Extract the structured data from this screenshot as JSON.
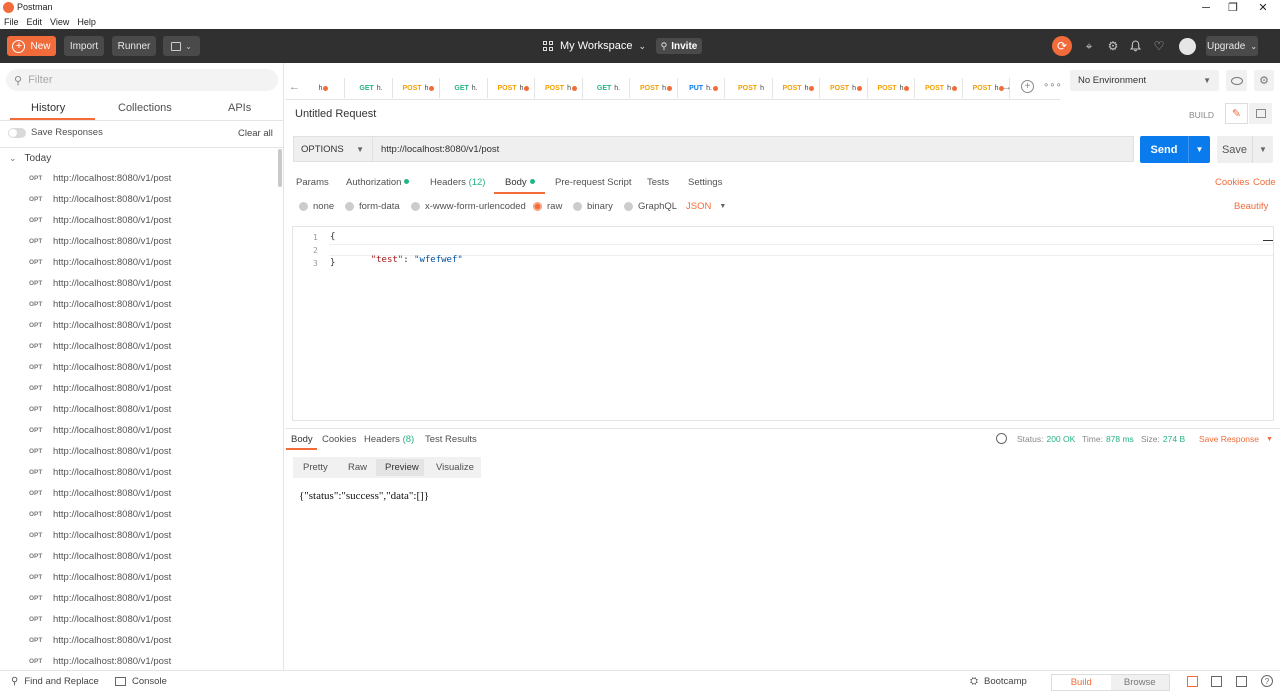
{
  "window": {
    "title": "Postman",
    "menu": [
      "File",
      "Edit",
      "View",
      "Help"
    ],
    "controls": {
      "minimize": "─",
      "maximize": "❐",
      "close": "✕"
    }
  },
  "header": {
    "new_label": "New",
    "import_label": "Import",
    "runner_label": "Runner",
    "workspace_label": "My Workspace",
    "invite_label": "Invite",
    "upgrade_label": "Upgrade"
  },
  "sidebar": {
    "filter_placeholder": "Filter",
    "tabs": [
      "History",
      "Collections",
      "APIs"
    ],
    "save_responses_label": "Save Responses",
    "clear_all_label": "Clear all",
    "group_label": "Today",
    "items": [
      {
        "method": "OPT",
        "url": "http://localhost:8080/v1/post"
      },
      {
        "method": "OPT",
        "url": "http://localhost:8080/v1/post"
      },
      {
        "method": "OPT",
        "url": "http://localhost:8080/v1/post"
      },
      {
        "method": "OPT",
        "url": "http://localhost:8080/v1/post"
      },
      {
        "method": "OPT",
        "url": "http://localhost:8080/v1/post"
      },
      {
        "method": "OPT",
        "url": "http://localhost:8080/v1/post"
      },
      {
        "method": "OPT",
        "url": "http://localhost:8080/v1/post"
      },
      {
        "method": "OPT",
        "url": "http://localhost:8080/v1/post"
      },
      {
        "method": "OPT",
        "url": "http://localhost:8080/v1/post"
      },
      {
        "method": "OPT",
        "url": "http://localhost:8080/v1/post"
      },
      {
        "method": "OPT",
        "url": "http://localhost:8080/v1/post"
      },
      {
        "method": "OPT",
        "url": "http://localhost:8080/v1/post"
      },
      {
        "method": "OPT",
        "url": "http://localhost:8080/v1/post"
      },
      {
        "method": "OPT",
        "url": "http://localhost:8080/v1/post"
      },
      {
        "method": "OPT",
        "url": "http://localhost:8080/v1/post"
      },
      {
        "method": "OPT",
        "url": "http://localhost:8080/v1/post"
      },
      {
        "method": "OPT",
        "url": "http://localhost:8080/v1/post"
      },
      {
        "method": "OPT",
        "url": "http://localhost:8080/v1/post"
      },
      {
        "method": "OPT",
        "url": "http://localhost:8080/v1/post"
      },
      {
        "method": "OPT",
        "url": "http://localhost:8080/v1/post"
      },
      {
        "method": "OPT",
        "url": "http://localhost:8080/v1/post"
      },
      {
        "method": "OPT",
        "url": "http://localhost:8080/v1/post"
      },
      {
        "method": "OPT",
        "url": "http://localhost:8080/v1/post"
      },
      {
        "method": "OPT",
        "url": "http://localhost:8080/v1/post"
      }
    ]
  },
  "request_tabs": [
    {
      "method": "",
      "name": "h",
      "dot": true
    },
    {
      "method": "GET",
      "name": "h.",
      "dot": false
    },
    {
      "method": "POST",
      "name": "h",
      "dot": true
    },
    {
      "method": "GET",
      "name": "h.",
      "dot": false
    },
    {
      "method": "POST",
      "name": "h",
      "dot": true
    },
    {
      "method": "POST",
      "name": "h",
      "dot": true
    },
    {
      "method": "GET",
      "name": "h.",
      "dot": false
    },
    {
      "method": "POST",
      "name": "h",
      "dot": true
    },
    {
      "method": "PUT",
      "name": "h.",
      "dot": true
    },
    {
      "method": "POST",
      "name": "h",
      "dot": false
    },
    {
      "method": "POST",
      "name": "h",
      "dot": true
    },
    {
      "method": "POST",
      "name": "h",
      "dot": true
    },
    {
      "method": "POST",
      "name": "h",
      "dot": true
    },
    {
      "method": "POST",
      "name": "h",
      "dot": true
    },
    {
      "method": "POST",
      "name": "h",
      "dot": true
    }
  ],
  "environment": {
    "selected": "No Environment"
  },
  "request": {
    "name": "Untitled Request",
    "build_label": "BUILD",
    "method": "OPTIONS",
    "url": "http://localhost:8080/v1/post",
    "send_label": "Send",
    "save_label": "Save",
    "tabs": [
      {
        "label": "Params"
      },
      {
        "label": "Authorization",
        "dot": true
      },
      {
        "label": "Headers",
        "count": "(12)"
      },
      {
        "label": "Body",
        "dot": true
      },
      {
        "label": "Pre-request Script"
      },
      {
        "label": "Tests"
      },
      {
        "label": "Settings"
      }
    ],
    "cookies_label": "Cookies",
    "code_label": "Code",
    "body_types": [
      "none",
      "form-data",
      "x-www-form-urlencoded",
      "raw",
      "binary",
      "GraphQL"
    ],
    "selected_body_type": "raw",
    "format": "JSON",
    "beautify_label": "Beautify",
    "code_lines": [
      {
        "n": "1",
        "text": "{"
      },
      {
        "n": "2",
        "key": "\"test\"",
        "sep": ": ",
        "value": "\"wfefwef\""
      },
      {
        "n": "3",
        "text": "}"
      }
    ]
  },
  "response": {
    "tabs": [
      {
        "label": "Body"
      },
      {
        "label": "Cookies"
      },
      {
        "label": "Headers",
        "count": "(8)"
      },
      {
        "label": "Test Results"
      }
    ],
    "status_label": "Status:",
    "status_value": "200 OK",
    "time_label": "Time:",
    "time_value": "878 ms",
    "size_label": "Size:",
    "size_value": "274 B",
    "save_response_label": "Save Response",
    "view_tabs": [
      "Pretty",
      "Raw",
      "Preview",
      "Visualize"
    ],
    "selected_view": "Preview",
    "body_text": "{\"status\":\"success\",\"data\":[]}"
  },
  "footer": {
    "find_replace_label": "Find and Replace",
    "console_label": "Console",
    "bootcamp_label": "Bootcamp",
    "build_label": "Build",
    "browse_label": "Browse"
  },
  "colors": {
    "accent": "#f26b3a",
    "header_bg": "#303030",
    "send_button": "#097bed",
    "success": "#26b47f",
    "get": "#26b47f",
    "post": "#f4a000",
    "put": "#097bed"
  }
}
